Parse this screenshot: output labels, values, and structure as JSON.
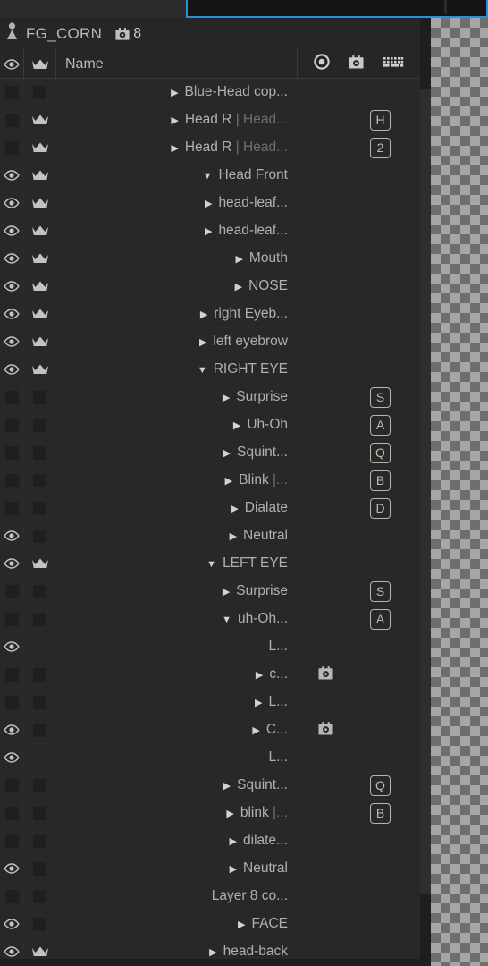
{
  "window": {
    "background_color": "#252525",
    "accent_color": "#2a8fd4"
  },
  "composition_header": {
    "icon": "puppet-pin-icon",
    "title": "FG_CORN",
    "camera_icon": "camera-icon",
    "count": "8"
  },
  "columns": {
    "visibility": "eye-icon",
    "trigger": "crown-icon",
    "name_label": "Name",
    "icons": [
      "record-icon",
      "camera-icon",
      "keyboard-icon"
    ]
  },
  "layers": [
    {
      "name": "Blue-Head cop...",
      "sub": "",
      "indent": 2,
      "twirl": "closed",
      "visible": false,
      "crown": false,
      "box": true,
      "badge": "",
      "camera": false
    },
    {
      "name": "Head R",
      "sub": "| Head...",
      "indent": 2,
      "twirl": "closed",
      "visible": false,
      "crown": true,
      "box": true,
      "badge": "H",
      "camera": false
    },
    {
      "name": "Head R",
      "sub": "| Head...",
      "indent": 2,
      "twirl": "closed",
      "visible": false,
      "crown": true,
      "box": true,
      "badge": "2",
      "camera": false
    },
    {
      "name": "Head Front",
      "sub": "",
      "indent": 2,
      "twirl": "open",
      "visible": true,
      "crown": true,
      "box": false,
      "badge": "",
      "camera": false
    },
    {
      "name": "head-leaf...",
      "sub": "",
      "indent": 3,
      "twirl": "closed",
      "visible": true,
      "crown": true,
      "box": false,
      "badge": "",
      "camera": false
    },
    {
      "name": "head-leaf...",
      "sub": "",
      "indent": 3,
      "twirl": "closed",
      "visible": true,
      "crown": true,
      "box": false,
      "badge": "",
      "camera": false
    },
    {
      "name": "Mouth",
      "sub": "",
      "indent": 3,
      "twirl": "closed",
      "visible": true,
      "crown": true,
      "box": false,
      "badge": "",
      "camera": false
    },
    {
      "name": "NOSE",
      "sub": "",
      "indent": 3,
      "twirl": "closed",
      "visible": true,
      "crown": true,
      "box": false,
      "badge": "",
      "camera": false
    },
    {
      "name": "right Eyeb...",
      "sub": "",
      "indent": 3,
      "twirl": "closed",
      "visible": true,
      "crown": true,
      "box": false,
      "badge": "",
      "camera": false
    },
    {
      "name": "left eyebrow",
      "sub": "",
      "indent": 3,
      "twirl": "closed",
      "visible": true,
      "crown": true,
      "box": false,
      "badge": "",
      "camera": false
    },
    {
      "name": "RIGHT EYE",
      "sub": "",
      "indent": 3,
      "twirl": "open",
      "visible": true,
      "crown": true,
      "box": false,
      "badge": "",
      "camera": false
    },
    {
      "name": "Surprise",
      "sub": "",
      "indent": 4,
      "twirl": "closed",
      "visible": false,
      "crown": false,
      "box": true,
      "badge": "S",
      "camera": false
    },
    {
      "name": "Uh-Oh",
      "sub": "",
      "indent": 4,
      "twirl": "closed",
      "visible": false,
      "crown": false,
      "box": true,
      "badge": "A",
      "camera": false
    },
    {
      "name": "Squint...",
      "sub": "",
      "indent": 4,
      "twirl": "closed",
      "visible": false,
      "crown": false,
      "box": true,
      "badge": "Q",
      "camera": false
    },
    {
      "name": "Blink",
      "sub": "|...",
      "indent": 4,
      "twirl": "closed",
      "visible": false,
      "crown": false,
      "box": true,
      "badge": "B",
      "camera": false
    },
    {
      "name": "Dialate",
      "sub": "",
      "indent": 4,
      "twirl": "closed",
      "visible": false,
      "crown": false,
      "box": true,
      "badge": "D",
      "camera": false
    },
    {
      "name": "Neutral",
      "sub": "",
      "indent": 4,
      "twirl": "closed",
      "visible": true,
      "crown": false,
      "box": true,
      "badge": "",
      "camera": false
    },
    {
      "name": "LEFT EYE",
      "sub": "",
      "indent": 3,
      "twirl": "open",
      "visible": true,
      "crown": true,
      "box": false,
      "badge": "",
      "camera": false
    },
    {
      "name": "Surprise",
      "sub": "",
      "indent": 4,
      "twirl": "closed",
      "visible": false,
      "crown": false,
      "box": true,
      "badge": "S",
      "camera": false
    },
    {
      "name": "uh-Oh...",
      "sub": "",
      "indent": 4,
      "twirl": "open",
      "visible": false,
      "crown": false,
      "box": true,
      "badge": "A",
      "camera": false
    },
    {
      "name": "L...",
      "sub": "",
      "indent": 5,
      "twirl": "none",
      "visible": true,
      "crown": false,
      "box": false,
      "badge": "",
      "camera": false
    },
    {
      "name": "c...",
      "sub": "",
      "indent": 5,
      "twirl": "closed",
      "visible": false,
      "crown": false,
      "box": true,
      "badge": "",
      "camera": true
    },
    {
      "name": "L...",
      "sub": "",
      "indent": 5,
      "twirl": "closed",
      "visible": false,
      "crown": false,
      "box": true,
      "badge": "",
      "camera": false
    },
    {
      "name": "C...",
      "sub": "",
      "indent": 5,
      "twirl": "closed",
      "visible": true,
      "crown": false,
      "box": true,
      "badge": "",
      "camera": true
    },
    {
      "name": "L...",
      "sub": "",
      "indent": 5,
      "twirl": "none",
      "visible": true,
      "crown": false,
      "box": false,
      "badge": "",
      "camera": false
    },
    {
      "name": "Squint...",
      "sub": "",
      "indent": 4,
      "twirl": "closed",
      "visible": false,
      "crown": false,
      "box": true,
      "badge": "Q",
      "camera": false
    },
    {
      "name": "blink",
      "sub": "|...",
      "indent": 4,
      "twirl": "closed",
      "visible": false,
      "crown": false,
      "box": true,
      "badge": "B",
      "camera": false
    },
    {
      "name": "dilate...",
      "sub": "",
      "indent": 4,
      "twirl": "closed",
      "visible": false,
      "crown": false,
      "box": true,
      "badge": "",
      "camera": false
    },
    {
      "name": "Neutral",
      "sub": "",
      "indent": 4,
      "twirl": "closed",
      "visible": true,
      "crown": false,
      "box": true,
      "badge": "",
      "camera": false
    },
    {
      "name": "Layer 8 co...",
      "sub": "",
      "indent": 3,
      "twirl": "none",
      "visible": false,
      "crown": false,
      "box": true,
      "badge": "",
      "camera": false
    },
    {
      "name": "FACE",
      "sub": "",
      "indent": 2,
      "twirl": "closed",
      "visible": true,
      "crown": false,
      "box": true,
      "badge": "",
      "camera": false
    },
    {
      "name": "head-back",
      "sub": "",
      "indent": 2,
      "twirl": "closed",
      "visible": true,
      "crown": true,
      "box": false,
      "badge": "",
      "camera": false
    }
  ]
}
